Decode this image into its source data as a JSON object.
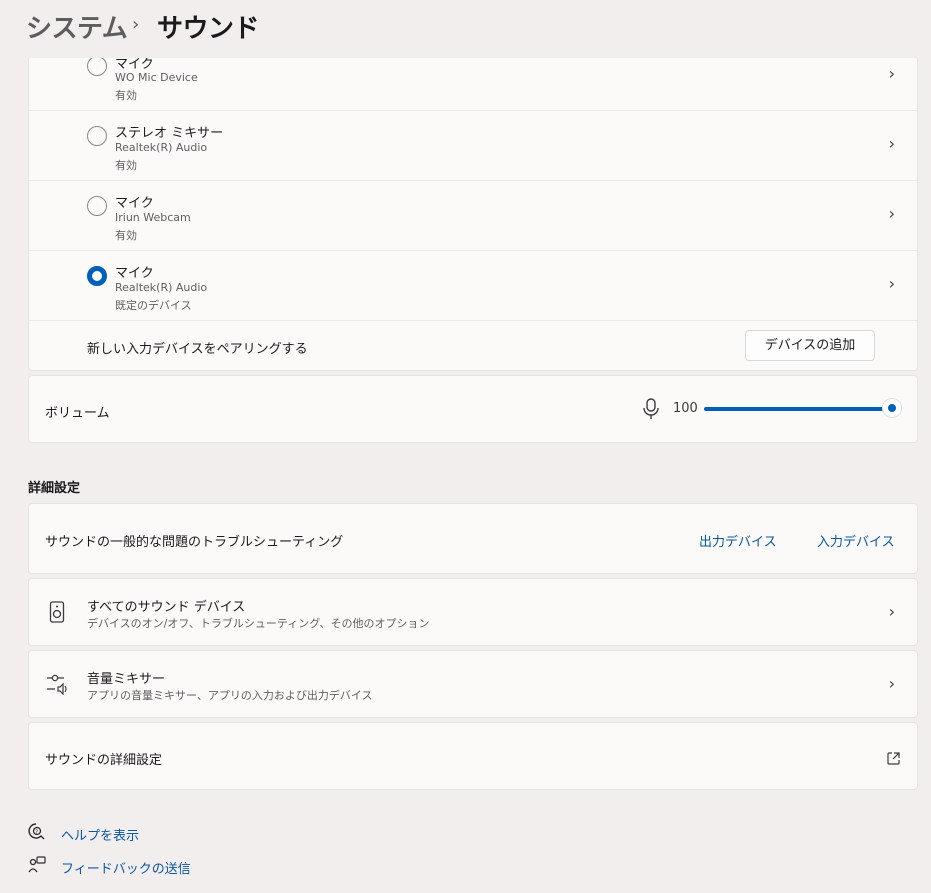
{
  "breadcrumb": {
    "parent": "システム",
    "separator": "›",
    "current": "サウンド"
  },
  "input_devices": [
    {
      "name": "マイク",
      "device": "WO Mic Device",
      "status": "有効",
      "selected": false
    },
    {
      "name": "ステレオ ミキサー",
      "device": "Realtek(R) Audio",
      "status": "有効",
      "selected": false
    },
    {
      "name": "マイク",
      "device": "Iriun Webcam",
      "status": "有効",
      "selected": false
    },
    {
      "name": "マイク",
      "device": "Realtek(R) Audio",
      "status": "既定のデバイス",
      "selected": true
    }
  ],
  "pair": {
    "label": "新しい入力デバイスをペアリングする",
    "button": "デバイスの追加"
  },
  "volume": {
    "label": "ボリューム",
    "value": "100",
    "level": 1.0
  },
  "advanced": {
    "title": "詳細設定",
    "troubleshoot": {
      "label": "サウンドの一般的な問題のトラブルシューティング",
      "output_link": "出力デバイス",
      "input_link": "入力デバイス"
    },
    "all_devices": {
      "title": "すべてのサウンド デバイス",
      "subtitle": "デバイスのオン/オフ、トラブルシューティング、その他のオプション"
    },
    "mixer": {
      "title": "音量ミキサー",
      "subtitle": "アプリの音量ミキサー、アプリの入力および出力デバイス"
    },
    "more": {
      "label": "サウンドの詳細設定"
    }
  },
  "footer": {
    "help": "ヘルプを表示",
    "feedback": "フィードバックの送信"
  },
  "colors": {
    "accent": "#005fb8",
    "link": "#0a57a4",
    "background": "#f3eeee",
    "card": "#fbfaf9"
  }
}
